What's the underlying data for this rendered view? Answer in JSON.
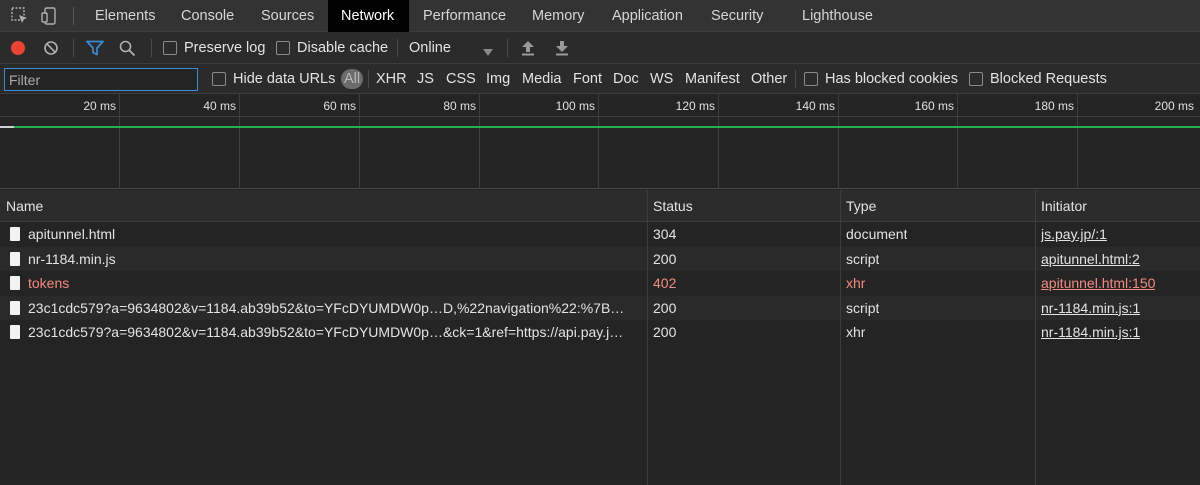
{
  "tabs": [
    "Elements",
    "Console",
    "Sources",
    "Network",
    "Performance",
    "Memory",
    "Application",
    "Security",
    "Lighthouse"
  ],
  "active_tab": "Network",
  "toolbar": {
    "preserve_log": "Preserve log",
    "disable_cache": "Disable cache",
    "throttling": "Online"
  },
  "filterbar": {
    "filter_placeholder": "Filter",
    "hide_data_urls": "Hide data URLs",
    "types": [
      "All",
      "XHR",
      "JS",
      "CSS",
      "Img",
      "Media",
      "Font",
      "Doc",
      "WS",
      "Manifest",
      "Other"
    ],
    "active_type": "All",
    "has_blocked_cookies": "Has blocked cookies",
    "blocked_requests": "Blocked Requests"
  },
  "overview": {
    "ticks": [
      "20 ms",
      "40 ms",
      "60 ms",
      "80 ms",
      "100 ms",
      "120 ms",
      "140 ms",
      "160 ms",
      "180 ms",
      "200 ms"
    ]
  },
  "table": {
    "columns": [
      "Name",
      "Status",
      "Type",
      "Initiator"
    ],
    "rows": [
      {
        "name": "apitunnel.html",
        "status": "304",
        "type": "document",
        "initiator": "js.pay.jp/:1",
        "error": false
      },
      {
        "name": "nr-1184.min.js",
        "status": "200",
        "type": "script",
        "initiator": "apitunnel.html:2",
        "error": false
      },
      {
        "name": "tokens",
        "status": "402",
        "type": "xhr",
        "initiator": "apitunnel.html:150",
        "error": true
      },
      {
        "name": "23c1cdc579?a=9634802&v=1184.ab39b52&to=YFcDYUMDW0p…D,%22navigation%22:%7B…",
        "status": "200",
        "type": "script",
        "initiator": "nr-1184.min.js:1",
        "error": false
      },
      {
        "name": "23c1cdc579?a=9634802&v=1184.ab39b52&to=YFcDYUMDW0p…&ck=1&ref=https://api.pay.j…",
        "status": "200",
        "type": "xhr",
        "initiator": "nr-1184.min.js:1",
        "error": false
      }
    ]
  },
  "colors": {
    "accent_blue": "#3b8bd6",
    "record_red": "#e94436",
    "timeline_green": "#23b14d",
    "error_text": "#f28b82"
  }
}
